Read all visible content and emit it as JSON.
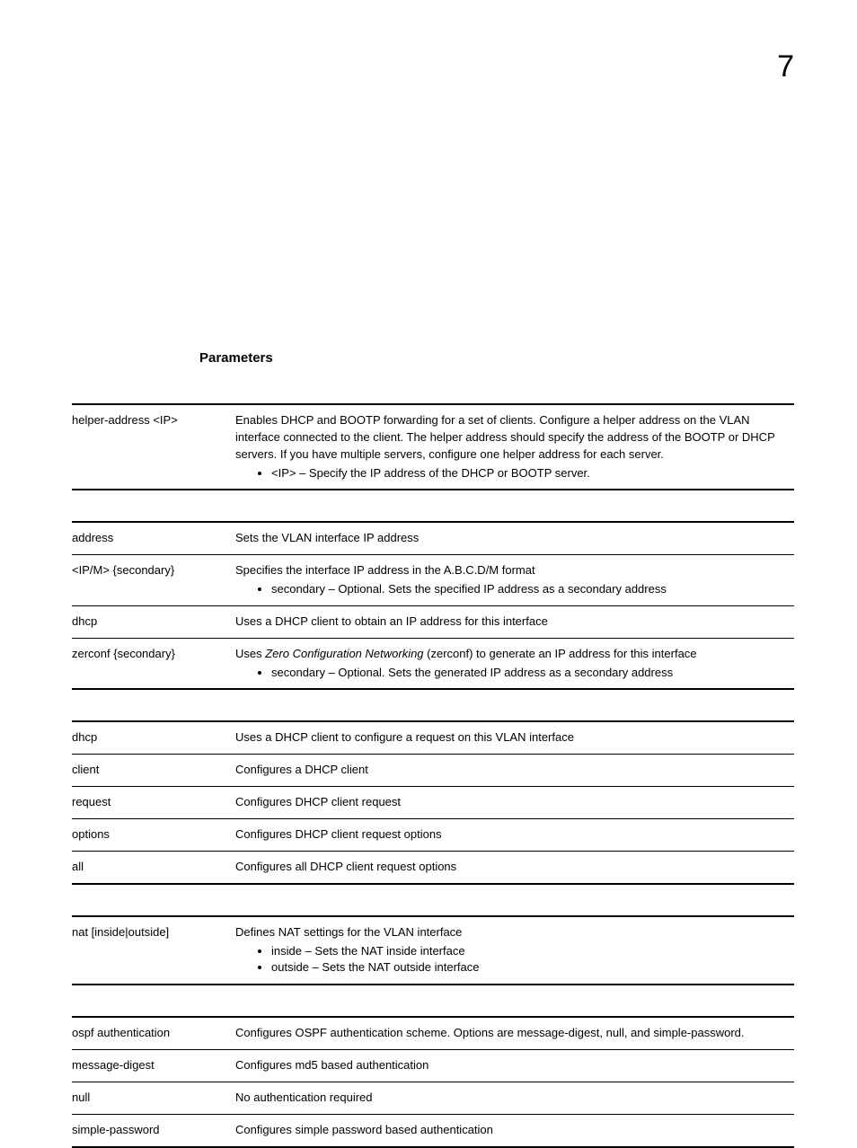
{
  "page_number": "7",
  "section_heading": "Parameters",
  "tables": [
    {
      "rows": [
        {
          "name": "helper-address <IP>",
          "desc_lines": [
            "Enables DHCP and BOOTP forwarding for a set of clients. Configure a helper address on the VLAN interface connected to the client. The helper address should specify the address of the BOOTP or DHCP servers. If you have multiple servers, configure one helper address for each server."
          ],
          "bullets": [
            "<IP> – Specify the IP address of the DHCP or BOOTP server."
          ]
        }
      ]
    },
    {
      "rows": [
        {
          "name": "address",
          "desc_lines": [
            "Sets the VLAN interface IP address"
          ],
          "bullets": []
        },
        {
          "name": "<IP/M> {secondary}",
          "desc_lines": [
            "Specifies the interface IP address in the A.B.C.D/M format"
          ],
          "bullets": [
            "secondary – Optional. Sets the specified IP address as a secondary address"
          ]
        },
        {
          "name": "dhcp",
          "desc_lines": [
            "Uses a DHCP client to obtain an IP address for this interface"
          ],
          "bullets": []
        },
        {
          "name": "zerconf {secondary}",
          "desc_lines_html": "Uses <span class=\"italic\">Zero Configuration Networking</span> (zerconf) to generate an IP address for this interface",
          "bullets": [
            "secondary – Optional. Sets the generated IP address as a secondary address"
          ]
        }
      ]
    },
    {
      "rows": [
        {
          "name": "dhcp",
          "desc_lines": [
            "Uses a DHCP client to configure a request on this VLAN interface"
          ],
          "bullets": []
        },
        {
          "name": "client",
          "desc_lines": [
            "Configures a DHCP client"
          ],
          "bullets": []
        },
        {
          "name": "request",
          "desc_lines": [
            "Configures DHCP client request"
          ],
          "bullets": []
        },
        {
          "name": "options",
          "desc_lines": [
            "Configures DHCP client request options"
          ],
          "bullets": []
        },
        {
          "name": "all",
          "desc_lines": [
            "Configures all DHCP client request options"
          ],
          "bullets": []
        }
      ]
    },
    {
      "rows": [
        {
          "name": "nat [inside|outside]",
          "desc_lines": [
            "Defines NAT settings for the VLAN interface"
          ],
          "bullets": [
            "inside – Sets the NAT inside interface",
            "outside – Sets the NAT outside interface"
          ]
        }
      ]
    },
    {
      "rows": [
        {
          "name": "ospf authentication",
          "desc_lines": [
            "Configures OSPF authentication scheme. Options are message-digest, null, and simple-password."
          ],
          "bullets": []
        },
        {
          "name": "message-digest",
          "desc_lines": [
            "Configures md5 based authentication"
          ],
          "bullets": []
        },
        {
          "name": "null",
          "desc_lines": [
            "No authentication required"
          ],
          "bullets": []
        },
        {
          "name": "simple-password",
          "desc_lines": [
            "Configures simple password based authentication"
          ],
          "bullets": []
        }
      ]
    }
  ]
}
